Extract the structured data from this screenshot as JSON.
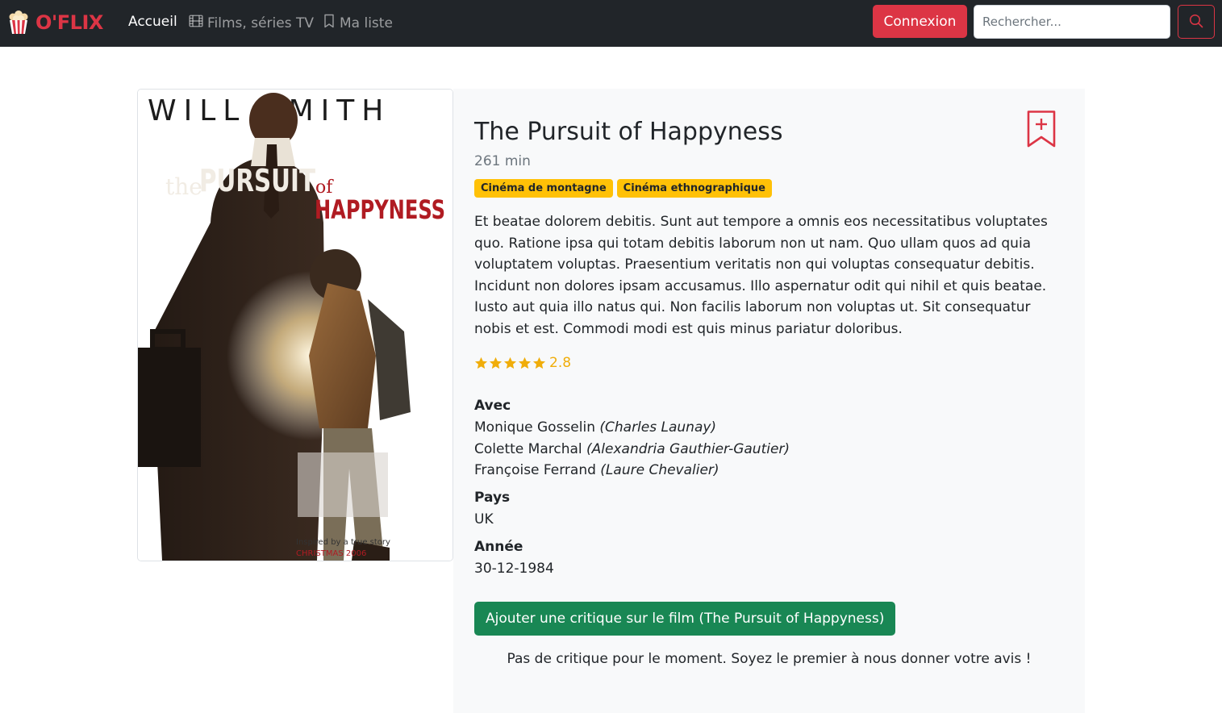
{
  "navbar": {
    "brand": "O'FLIX",
    "links": [
      {
        "label": "Accueil",
        "icon": "",
        "active": true
      },
      {
        "label": "Films, séries TV",
        "icon": "film-icon",
        "active": false
      },
      {
        "label": "Ma liste",
        "icon": "bookmark-icon",
        "active": false
      }
    ],
    "login_label": "Connexion",
    "search_placeholder": "Rechercher...",
    "search_value": ""
  },
  "movie": {
    "poster": {
      "title_top": "WILL SMITH",
      "title_the": "the",
      "title_pursuit": "PURSUIT",
      "title_of": "of",
      "title_happyness": "HAPPYNESS",
      "tagline": "Inspired by a true story",
      "release": "CHRISTMAS 2006"
    },
    "title": "The Pursuit of Happyness",
    "duration": "261 min",
    "genres": [
      "Cinéma de montagne",
      "Cinéma ethnographique"
    ],
    "synopsis": "Et beatae dolorem debitis. Sunt aut tempore a omnis eos necessitatibus voluptates quo. Ratione ipsa qui totam debitis laborum non ut nam. Quo ullam quos ad quia voluptatem voluptas. Praesentium veritatis non qui voluptas consequatur debitis. Incidunt non dolores ipsam accusamus. Illo aspernatur odit qui nihil et quis beatae. Iusto aut quia illo natus qui. Non facilis laborum non voluptas ut. Sit consequatur nobis et est. Commodi modi est quis minus pariatur doloribus.",
    "rating": "2.8",
    "stars": 5,
    "cast_label": "Avec",
    "cast": [
      {
        "actor": "Monique Gosselin",
        "role": "(Charles Launay)"
      },
      {
        "actor": "Colette Marchal",
        "role": "(Alexandria Gauthier-Gautier)"
      },
      {
        "actor": "Françoise Ferrand",
        "role": "(Laure Chevalier)"
      }
    ],
    "country_label": "Pays",
    "country": "UK",
    "year_label": "Année",
    "year": "30-12-1984",
    "review_button": "Ajouter une critique sur le film (The Pursuit of Happyness)",
    "no_review_text": "Pas de critique pour le moment. Soyez le premier à nous donner votre avis !"
  },
  "colors": {
    "navbar_bg": "#212529",
    "brand": "#dc3545",
    "badge": "#ffc107",
    "star": "#f0ad0a",
    "review_button": "#198754",
    "panel_bg": "#f8f9fa"
  }
}
